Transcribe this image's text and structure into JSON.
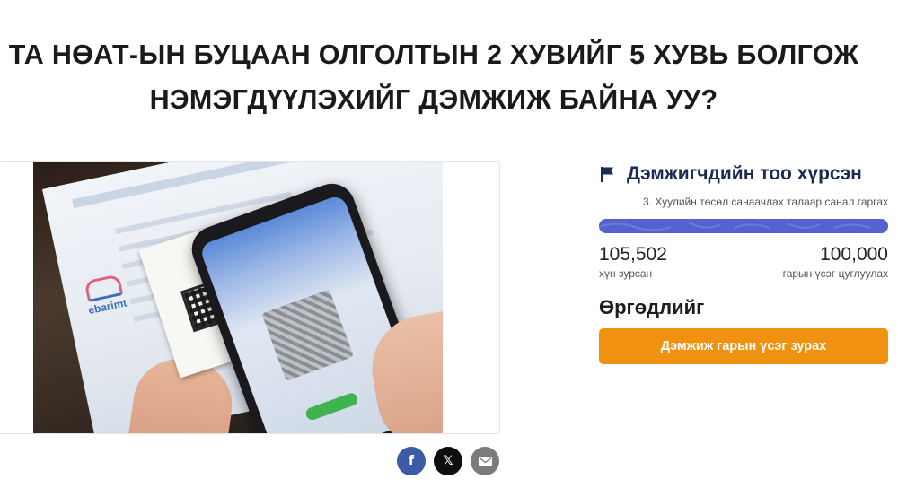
{
  "petition": {
    "title_line1": "ТА НӨАТ-ЫН БУЦААН ОЛГОЛТЫН 2 ХУВИЙГ 5 ХУВЬ БОЛГОЖ",
    "title_line2": "НЭМЭГДҮҮЛЭХИЙГ ДЭМЖИЖ БАЙНА УУ?"
  },
  "image": {
    "logo_text": "ebarimt"
  },
  "share": {
    "facebook_glyph": "f",
    "x_glyph": "𝕏",
    "email_icon": "envelope-icon"
  },
  "status": {
    "title": "Дэмжигчдийн тоо хүрсэн",
    "icon": "flag-icon",
    "subtitle": "3. Хуулийн төсөл санаачлах талаар санал гаргах",
    "progress_fraction": 1.0,
    "progress_color": "#5b69d1",
    "signed_count": "105,502",
    "signed_label": "хүн зурсан",
    "goal_count": "100,000",
    "goal_label": "гарын үсэг цуглуулах"
  },
  "description": {
    "heading": "Өргөдлийг"
  },
  "actions": {
    "sign_label": "Дэмжиж гарын үсэг зурах",
    "sign_color": "#f0920f"
  }
}
